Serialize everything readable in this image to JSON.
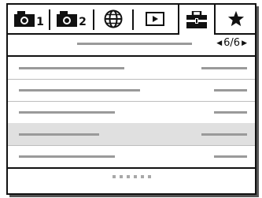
{
  "tabs": [
    {
      "icon": "camera-1-icon",
      "num": "1"
    },
    {
      "icon": "camera-2-icon",
      "num": "2"
    },
    {
      "icon": "globe-icon"
    },
    {
      "icon": "playback-icon"
    },
    {
      "icon": "toolbox-icon",
      "active": true
    },
    {
      "icon": "star-icon"
    }
  ],
  "header": {
    "page": "6/6",
    "prev_arrow": "◀",
    "next_arrow": "▶"
  },
  "rows": [
    {
      "selected": false
    },
    {
      "selected": false
    },
    {
      "selected": false
    },
    {
      "selected": true
    },
    {
      "selected": false
    }
  ],
  "pagination": {
    "dots": 6
  },
  "colors": {
    "border": "#111111",
    "placeholder": "#9a9a9a",
    "highlight": "#e0e0e0"
  }
}
